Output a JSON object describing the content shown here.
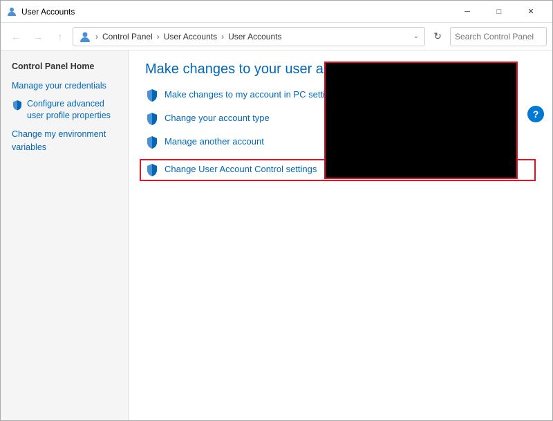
{
  "window": {
    "title": "User Accounts",
    "controls": {
      "minimize": "─",
      "maximize": "□",
      "close": "✕"
    }
  },
  "addressBar": {
    "back_disabled": true,
    "forward_disabled": true,
    "breadcrumbs": [
      "Control Panel",
      "User Accounts",
      "User Accounts"
    ],
    "search_placeholder": "Search Control Panel",
    "chevron": "˅",
    "refresh": "↻"
  },
  "sidebar": {
    "heading": "Control Panel Home",
    "links": [
      {
        "label": "Manage your credentials",
        "icon": false
      },
      {
        "label": "Configure advanced user profile properties",
        "icon": true
      },
      {
        "label": "Change my environment variables",
        "icon": false
      }
    ]
  },
  "main": {
    "title": "Make changes to your user account",
    "actions": [
      {
        "label": "Make changes to my account in PC settings",
        "icon": "uac",
        "highlighted": false
      },
      {
        "label": "Change your account type",
        "icon": "uac",
        "highlighted": false
      },
      {
        "label": "Manage another account",
        "icon": "uac",
        "highlighted": false
      },
      {
        "label": "Change User Account Control settings",
        "icon": "uac",
        "highlighted": true
      }
    ]
  },
  "help": {
    "label": "?"
  }
}
